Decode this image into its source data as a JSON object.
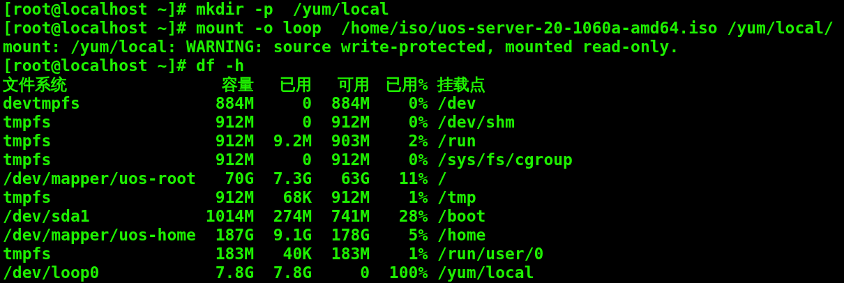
{
  "terminal": {
    "lines": [
      "[root@localhost ~]# mkdir -p  /yum/local",
      "[root@localhost ~]# mount -o loop  /home/iso/uos-server-20-1060a-amd64.iso /yum/local/",
      "mount: /yum/local: WARNING: source write-protected, mounted read-only.",
      "[root@localhost ~]# df -h"
    ],
    "df_table": {
      "columns": [
        "文件系统",
        "容量",
        "已用",
        "可用",
        "已用%",
        "挂载点"
      ],
      "rows": [
        [
          "devtmpfs",
          "884M",
          "0",
          "884M",
          "0%",
          "/dev"
        ],
        [
          "tmpfs",
          "912M",
          "0",
          "912M",
          "0%",
          "/dev/shm"
        ],
        [
          "tmpfs",
          "912M",
          "9.2M",
          "903M",
          "2%",
          "/run"
        ],
        [
          "tmpfs",
          "912M",
          "0",
          "912M",
          "0%",
          "/sys/fs/cgroup"
        ],
        [
          "/dev/mapper/uos-root",
          "70G",
          "7.3G",
          "63G",
          "11%",
          "/"
        ],
        [
          "tmpfs",
          "912M",
          "68K",
          "912M",
          "1%",
          "/tmp"
        ],
        [
          "/dev/sda1",
          "1014M",
          "274M",
          "741M",
          "28%",
          "/boot"
        ],
        [
          "/dev/mapper/uos-home",
          "187G",
          "9.1G",
          "178G",
          "5%",
          "/home"
        ],
        [
          "tmpfs",
          "183M",
          "40K",
          "183M",
          "1%",
          "/run/user/0"
        ],
        [
          "/dev/loop0",
          "7.8G",
          "7.8G",
          "0",
          "100%",
          "/yum/local"
        ]
      ]
    }
  }
}
